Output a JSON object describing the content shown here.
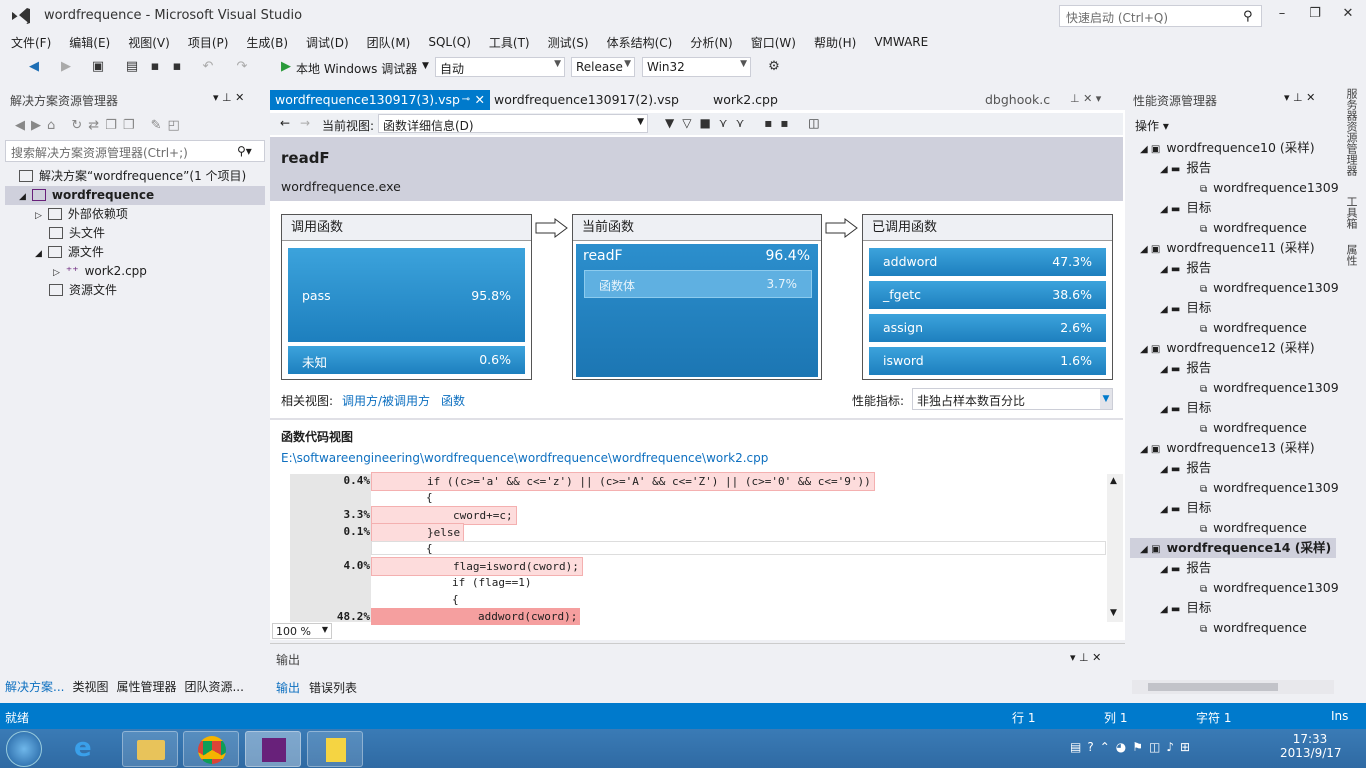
{
  "window": {
    "title": "wordfrequence - Microsoft Visual Studio",
    "quick_launch": "快速启动 (Ctrl+Q)"
  },
  "menu": [
    "文件(F)",
    "编辑(E)",
    "视图(V)",
    "项目(P)",
    "生成(B)",
    "调试(D)",
    "团队(M)",
    "SQL(Q)",
    "工具(T)",
    "测试(S)",
    "体系结构(C)",
    "分析(N)",
    "窗口(W)",
    "帮助(H)",
    "VMWARE"
  ],
  "toolbar": {
    "debug_target": "本地 Windows 调试器",
    "auto": "自动",
    "config": "Release",
    "platform": "Win32"
  },
  "solution": {
    "title": "解决方案资源管理器",
    "search": "搜索解决方案资源管理器(Ctrl+;)",
    "items": [
      "解决方案“wordfrequence”(1 个项目)",
      "wordfrequence",
      "外部依赖项",
      "头文件",
      "源文件",
      "work2.cpp",
      "资源文件"
    ],
    "bottom_tabs": [
      "解决方案...",
      "类视图",
      "属性管理器",
      "团队资源..."
    ]
  },
  "tabs": {
    "active": "wordfrequence130917(3).vsp",
    "t2": "wordfrequence130917(2).vsp",
    "t3": "work2.cpp",
    "t4": "dbghook.c"
  },
  "report": {
    "nav_label": "当前视图:",
    "view": "函数详细信息(D)",
    "func": "readF",
    "exe": "wordfrequence.exe",
    "callers_title": "调用函数",
    "callers": [
      {
        "name": "pass",
        "pct": "95.8%"
      },
      {
        "name": "未知",
        "pct": "0.6%"
      }
    ],
    "current_title": "当前函数",
    "current": {
      "name": "readF",
      "pct": "96.4%",
      "body": "函数体",
      "body_pct": "3.7%"
    },
    "callees_title": "已调用函数",
    "callees": [
      {
        "name": "addword",
        "pct": "47.3%"
      },
      {
        "name": "_fgetc",
        "pct": "38.6%"
      },
      {
        "name": "assign",
        "pct": "2.6%"
      },
      {
        "name": "isword",
        "pct": "1.6%"
      }
    ],
    "related": "相关视图:",
    "link1": "调用方/被调用方",
    "link2": "函数",
    "metric_label": "性能指标:",
    "metric": "非独占样本数百分比",
    "code_title": "函数代码视图",
    "path": "E:\\softwareengineering\\wordfrequence\\wordfrequence\\wordfrequence\\work2.cpp",
    "zoom": "100 %"
  },
  "code": [
    {
      "pct": "0.4%",
      "text": "if ((c>='a' && c<='z') || (c>='A' && c<='Z') || (c>='0' && c<='9'))",
      "hl": "1",
      "ind": 2
    },
    {
      "pct": "",
      "text": "{",
      "hl": "",
      "ind": 2
    },
    {
      "pct": "3.3%",
      "text": "cword+=c;",
      "hl": "1",
      "ind": 3
    },
    {
      "pct": "0.1%",
      "text": "}else",
      "hl": "1",
      "ind": 2
    },
    {
      "pct": "",
      "text": "{",
      "hl": "",
      "ind": 2
    },
    {
      "pct": "4.0%",
      "text": "flag=isword(cword);",
      "hl": "1",
      "ind": 3
    },
    {
      "pct": "",
      "text": "if (flag==1)",
      "hl": "",
      "ind": 3
    },
    {
      "pct": "",
      "text": "{",
      "hl": "",
      "ind": 3
    },
    {
      "pct": "48.2%",
      "text": "addword(cword);",
      "hl": "2",
      "ind": 4
    }
  ],
  "output": {
    "title": "输出",
    "tabs": [
      "输出",
      "错误列表"
    ]
  },
  "perf": {
    "title": "性能资源管理器",
    "ops": "操作",
    "sessions": [
      "wordfrequence10 (采样)",
      "wordfrequence11 (采样)",
      "wordfrequence12 (采样)",
      "wordfrequence13 (采样)",
      "wordfrequence14 (采样)"
    ],
    "report": "报告",
    "target": "目标",
    "rep_item": "wordfrequence1309",
    "target_item": "wordfrequence"
  },
  "side_tabs": [
    "服务器资源管理器",
    "工具箱",
    "属性"
  ],
  "status": {
    "ready": "就绪",
    "line": "行 1",
    "col": "列 1",
    "ch": "字符 1",
    "ins": "Ins"
  },
  "clock": {
    "time": "17:33",
    "date": "2013/9/17"
  }
}
